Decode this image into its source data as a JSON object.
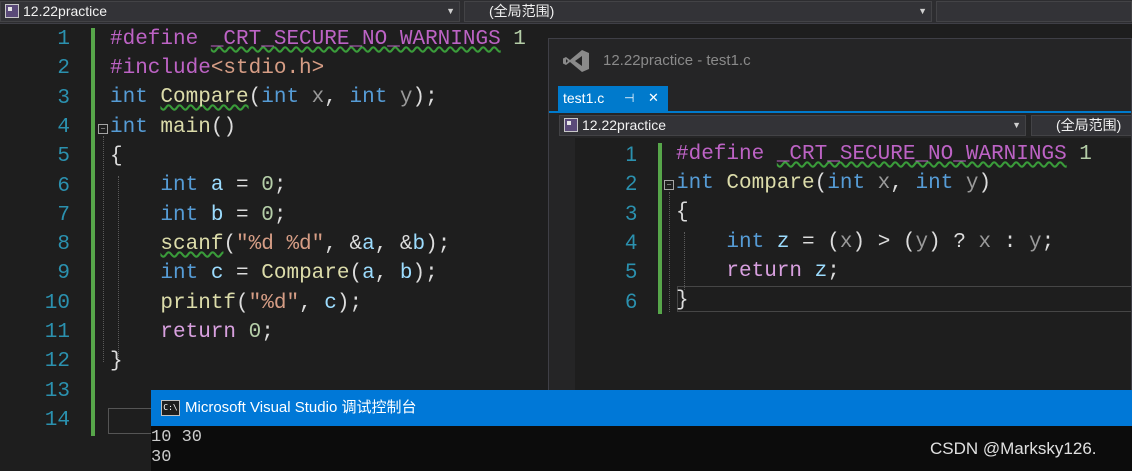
{
  "top_bar": {
    "project": "12.22practice",
    "scope": "(全局范围)"
  },
  "main_editor": {
    "line_numbers": [
      "1",
      "2",
      "3",
      "4",
      "5",
      "6",
      "7",
      "8",
      "9",
      "10",
      "11",
      "12",
      "13",
      "14"
    ]
  },
  "preview": {
    "title": "12.22practice - test1.c",
    "tab_label": "test1.c",
    "pin_glyph": "⊣",
    "close_glyph": "✕",
    "project": "12.22practice",
    "scope": "(全局范围)",
    "line_numbers": [
      "1",
      "2",
      "3",
      "4",
      "5",
      "6"
    ]
  },
  "console": {
    "title": "Microsoft Visual Studio 调试控制台",
    "icon_text": "C:\\",
    "lines": [
      "10 30",
      "30",
      "                                                                          "
    ]
  },
  "watermark": "CSDN @Marksky126.",
  "colors": {
    "accent": "#0078d7",
    "keyword": "#569cd6",
    "function": "#dcdcaa",
    "line_number": "#2b91af"
  }
}
